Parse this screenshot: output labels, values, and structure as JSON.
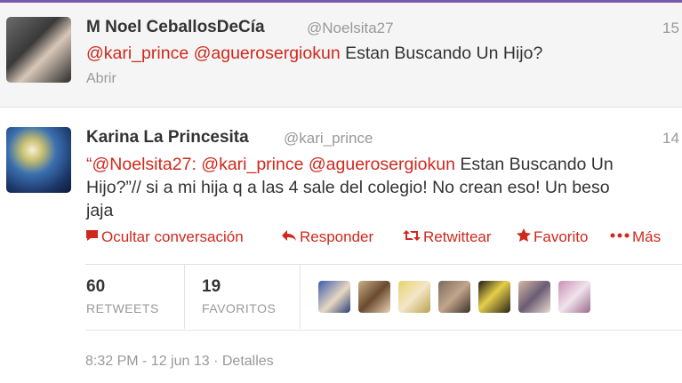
{
  "tweet1": {
    "name": "M Noel CeballosDeCía",
    "handle": "@Noelsita27",
    "time": "15",
    "mention1": "@kari_prince",
    "mention2": "@aguerosergiokun",
    "text_rest": " Estan Buscando Un Hijo?",
    "open_label": "Abrir"
  },
  "tweet2": {
    "name": "Karina La Princesita",
    "handle": "@kari_prince",
    "time": "14",
    "line1_open_quote": "“",
    "line1_mention1": "@Noelsita27",
    "line1_colon": ": ",
    "line1_mention2": "@kari_prince",
    "line1_space": " ",
    "line1_mention3": "@aguerosergiokun",
    "line1_rest": " Estan Buscando Un",
    "line2": "Hijo?”// si a mi hija q a las 4 sale del colegio! No crean eso! Un beso",
    "line3": "jaja",
    "actions": {
      "hide": "Ocultar conversación",
      "reply": "Responder",
      "retweet": "Retwittear",
      "favorite": "Favorito",
      "more": "Más"
    },
    "stats": {
      "retweets_count": "60",
      "retweets_label": "RETWEETS",
      "favorites_count": "19",
      "favorites_label": "FAVORITOS"
    },
    "footer": "8:32 PM - 12 jun 13 · Detalles"
  },
  "colors": {
    "mention": "#d0281c",
    "top_bar": "#7a5aa8",
    "muted": "#999999"
  },
  "icons": [
    "comment-icon",
    "reply-arrow-icon",
    "retweet-icon",
    "star-icon",
    "more-dots-icon"
  ]
}
